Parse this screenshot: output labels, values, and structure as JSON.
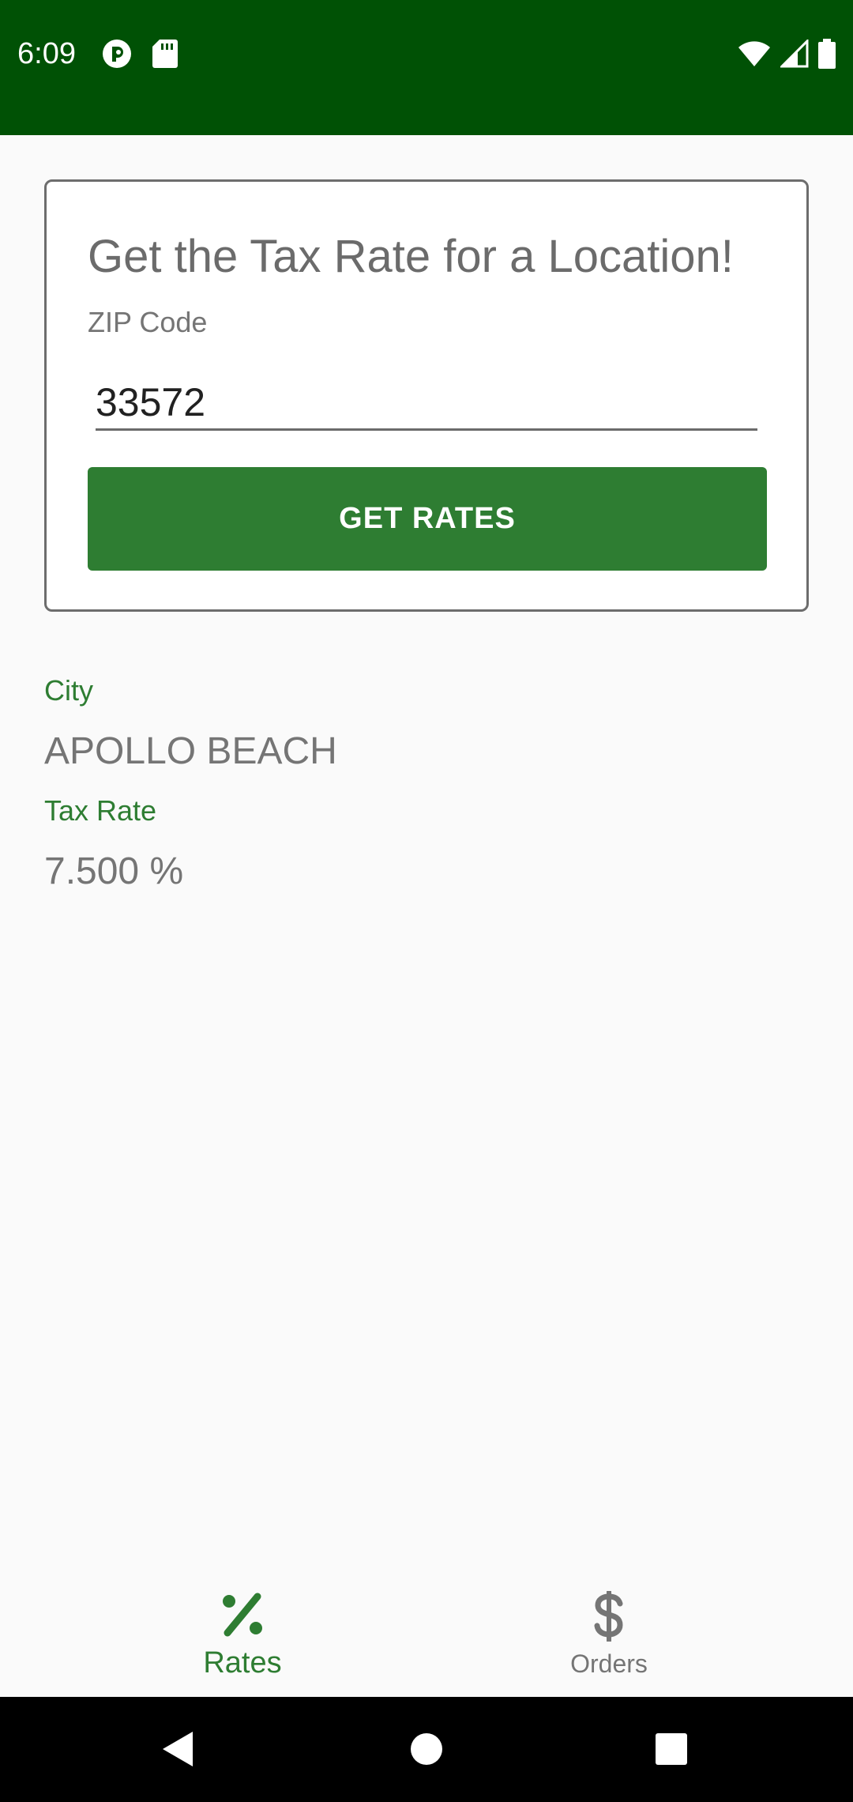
{
  "status_bar": {
    "time": "6:09",
    "background": "#005105",
    "left_icons": [
      "circle-app-icon",
      "sd-card-icon"
    ],
    "right_icons": [
      "wifi-icon",
      "signal-icon",
      "battery-icon"
    ]
  },
  "card": {
    "title": "Get the Tax Rate for a Location!",
    "zip_label": "ZIP Code",
    "zip_value": "33572",
    "button_label": "GET RATES"
  },
  "results": {
    "city_label": "City",
    "city_value": "APOLLO BEACH",
    "rate_label": "Tax Rate",
    "rate_value": "7.500 %"
  },
  "bottom_nav": {
    "items": [
      {
        "label": "Rates",
        "icon": "percent-icon",
        "selected": true
      },
      {
        "label": "Orders",
        "icon": "dollar-icon",
        "selected": false
      }
    ]
  },
  "colors": {
    "accent": "#2e7d32",
    "status_bar": "#005105",
    "text_secondary": "#757575"
  },
  "system_nav": {
    "buttons": [
      "back-icon",
      "home-icon",
      "recents-icon"
    ]
  }
}
